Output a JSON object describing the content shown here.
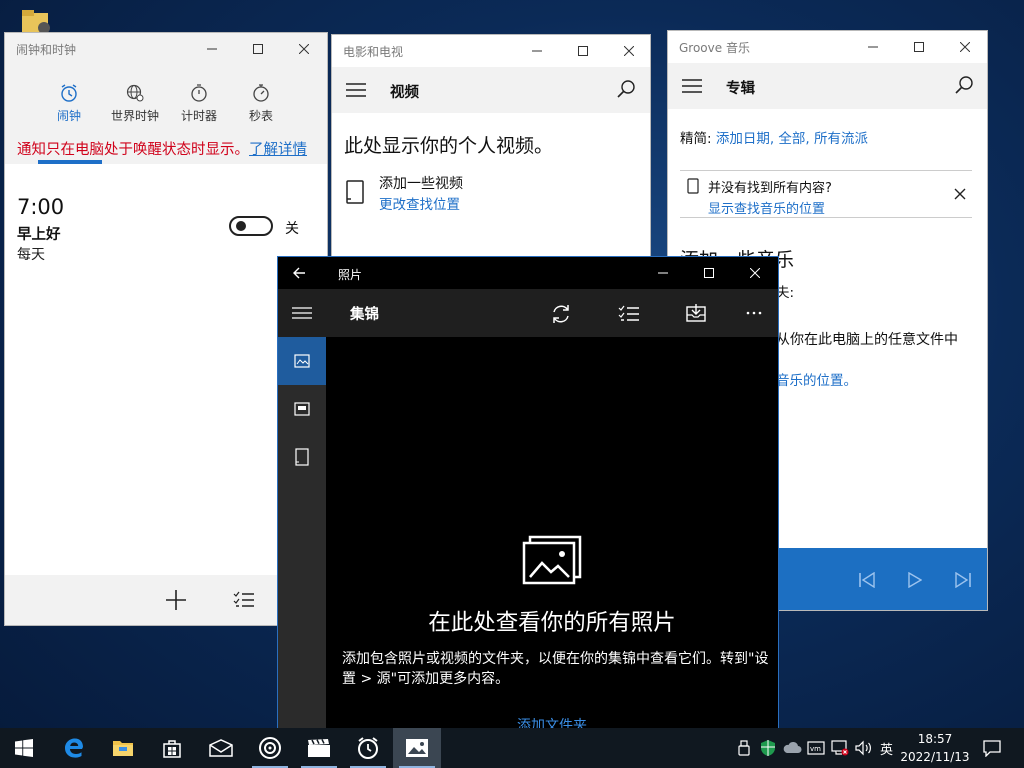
{
  "alarms_window": {
    "title": "闹钟和时钟",
    "tabs": [
      {
        "label": "闹钟",
        "icon": "alarm-clock-icon",
        "active": true
      },
      {
        "label": "世界时钟",
        "icon": "globe-icon"
      },
      {
        "label": "计时器",
        "icon": "stopwatch-icon"
      },
      {
        "label": "秒表",
        "icon": "stopwatch-icon"
      }
    ],
    "notice": "通知只在电脑处于唤醒状态时显示。",
    "notice_link": "了解详情",
    "alarm": {
      "time": "7:00",
      "name": "早上好",
      "repeat": "每天",
      "state_label": "关"
    }
  },
  "movies_window": {
    "title": "电影和电视",
    "section": "视频",
    "heading": "此处显示你的个人视频。",
    "add_label": "添加一些视频",
    "change_location_link": "更改查找位置"
  },
  "groove_window": {
    "title": "Groove 音乐",
    "section": "专辑",
    "filter_prefix": "精简: ",
    "filter_value": "添加日期, 全部, 所有流派",
    "question": "并没有找到所有内容?",
    "question_link": "显示查找音乐的位置",
    "add_heading": "添加一些音乐",
    "partial_text_1": "夫:",
    "partial_text_2": "从你在此电脑上的任意文件中",
    "partial_link": "音乐的位置。"
  },
  "photos_window": {
    "title": "照片",
    "section": "集锦",
    "heading": "在此处查看你的所有照片",
    "description": "添加包含照片或视频的文件夹，以便在你的集锦中查看它们。转到\"设置 > 源\"可添加更多内容。",
    "add_folder_link": "添加文件夹"
  },
  "taskbar": {
    "apps": [
      "start",
      "edge",
      "file-explorer",
      "store",
      "mail",
      "groove",
      "movies",
      "alarms",
      "photos"
    ],
    "ime": "英",
    "time": "18:57",
    "date": "2022/11/13"
  },
  "colors": {
    "accent": "#1e6fc8",
    "notice_red": "#d0021b",
    "groove_player": "#1c6fc2",
    "photos_active": "#1f5c9e"
  }
}
